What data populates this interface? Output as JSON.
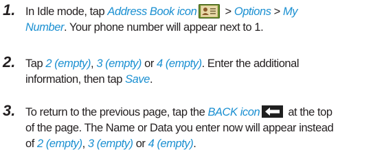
{
  "steps": [
    {
      "number": "1.",
      "line1": {
        "t1": "In Idle mode, tap ",
        "link_address_book": "Address Book icon",
        "t2": " > ",
        "link_options": "Options",
        "t3": " > ",
        "link_my": "My"
      },
      "line2": {
        "link_number": "Number",
        "t1": ". Your phone number will appear next to 1."
      }
    },
    {
      "number": "2.",
      "line1": {
        "t1": "Tap ",
        "link_2": "2 (empty)",
        "t2": ", ",
        "link_3": "3 (empty)",
        "t3": " or ",
        "link_4": "4 (empty)",
        "t4": ". Enter the additional"
      },
      "line2": {
        "t1": "information, then tap ",
        "link_save": "Save",
        "t2": "."
      }
    },
    {
      "number": "3.",
      "line1": {
        "t1": "To return to the previous page, tap the ",
        "link_back": "BACK icon",
        "t2": " at the top"
      },
      "line2": {
        "t1": "of the page. The Name or Data you enter now will appear instead"
      },
      "line3": {
        "t1": "of ",
        "link_2": "2 (empty)",
        "t2": ", ",
        "link_3": "3 (empty)",
        "t3": " or ",
        "link_4": "4 (empty)",
        "t4": "."
      }
    }
  ],
  "icons": {
    "address_book": "address-book-icon",
    "back": "back-arrow-icon"
  },
  "colors": {
    "link": "#1a8fd1",
    "text": "#231f20"
  }
}
